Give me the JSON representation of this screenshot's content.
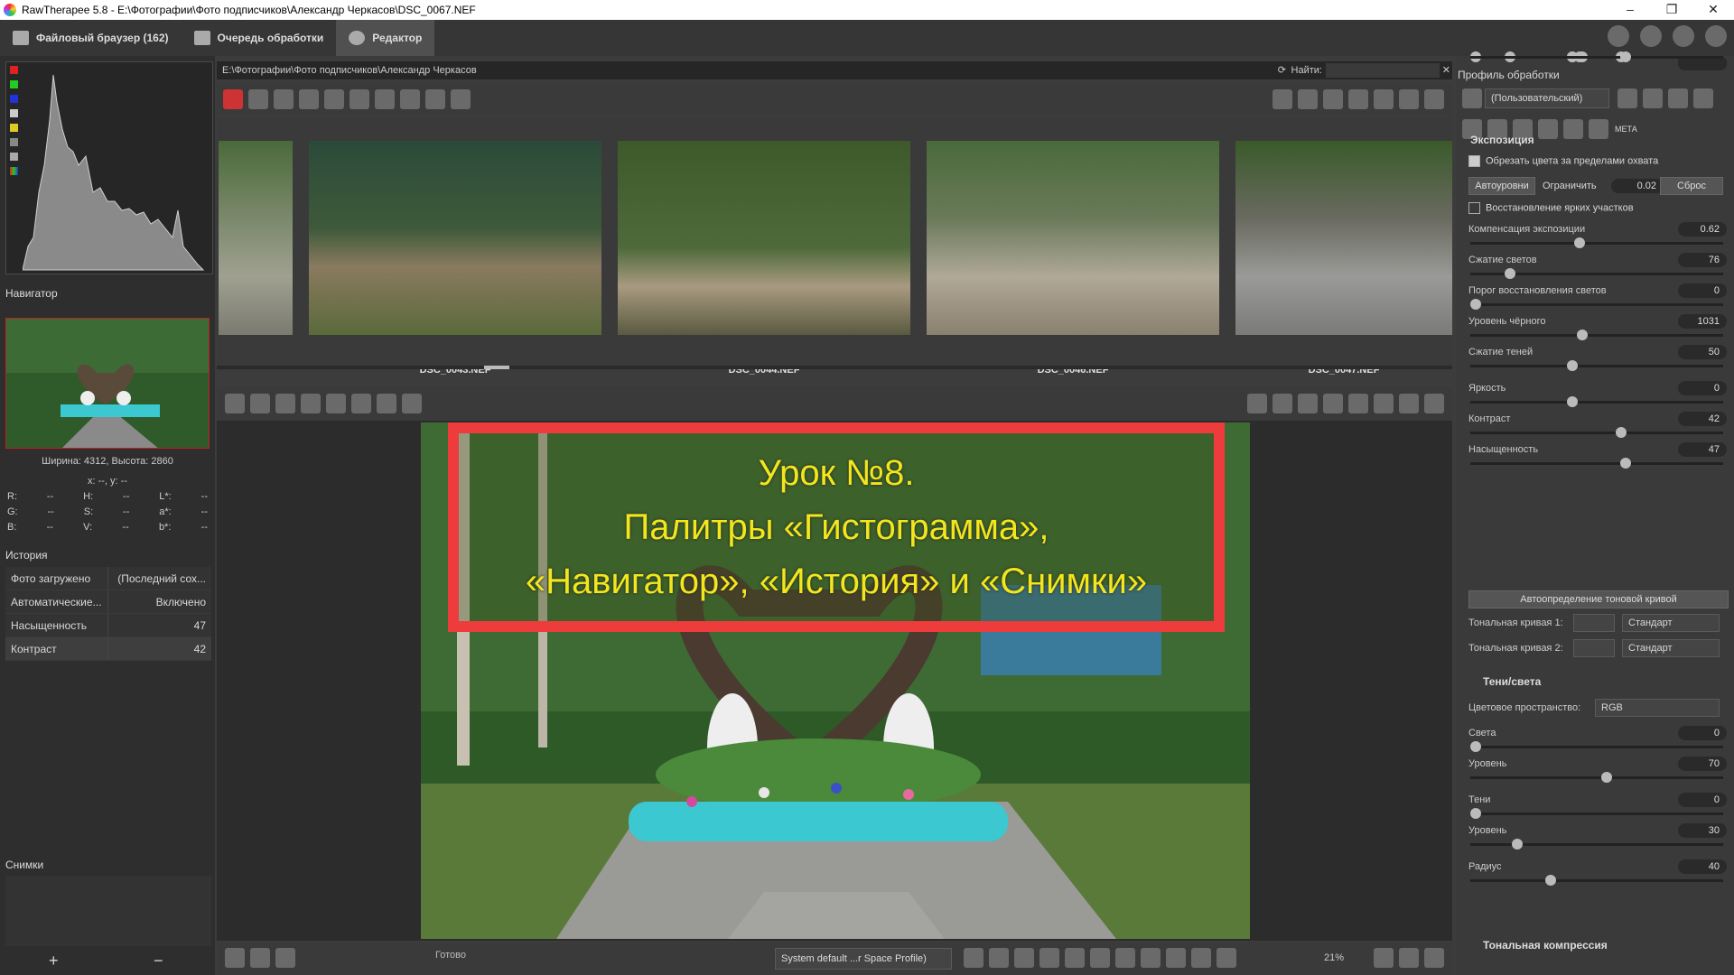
{
  "window": {
    "title": "RawTherapee 5.8 - E:\\Фотографии\\Фото подписчиков\\Александр Черкасов\\DSC_0067.NEF",
    "min": "–",
    "max": "❐",
    "close": "✕"
  },
  "tabs": [
    {
      "label": "Файловый браузер (162)"
    },
    {
      "label": "Очередь обработки"
    },
    {
      "label": "Редактор"
    }
  ],
  "left": {
    "navigator_title": "Навигатор",
    "dims": "Ширина: 4312, Высота: 2860",
    "coords": "x: --, y: --",
    "info": [
      [
        "R:",
        "--",
        "H:",
        "--",
        "L*:",
        "--"
      ],
      [
        "G:",
        "--",
        "S:",
        "--",
        "a*:",
        "--"
      ],
      [
        "B:",
        "--",
        "V:",
        "--",
        "b*:",
        "--"
      ]
    ],
    "history_title": "История",
    "history": [
      {
        "action": "Фото загружено",
        "value": "(Последний сох..."
      },
      {
        "action": "Автоматические...",
        "value": "Включено"
      },
      {
        "action": "Насыщенность",
        "value": "47"
      },
      {
        "action": "Контраст",
        "value": "42"
      }
    ],
    "snapshots_title": "Снимки",
    "add": "+",
    "remove": "−"
  },
  "filmstrip": {
    "path": "E:\\Фотографии\\Фото подписчиков\\Александр Черкасов",
    "find_label": "Найти:",
    "find_value": "",
    "thumbs": [
      {
        "name": ""
      },
      {
        "name": "DSC_0043.NEF"
      },
      {
        "name": "DSC_0044.NEF"
      },
      {
        "name": "DSC_0046.NEF"
      },
      {
        "name": "DSC_0047.NEF"
      }
    ]
  },
  "overlay": {
    "line1": "Урок №8.",
    "line2": "Палитры «Гистограмма»,",
    "line3": "«Навигатор», «История» и «Снимки»"
  },
  "bottom": {
    "status": "Готово",
    "profile": "System default ...r Space Profile)",
    "zoom": "21%"
  },
  "right": {
    "profile_title": "Профиль обработки",
    "profile_value": "(Пользовательский)",
    "meta_tab": "МЕТА",
    "exposure_title": "Экспозиция",
    "clip_oog": "Обрезать цвета за пределами охвата",
    "autolevels": "Автоуровни",
    "clip_label": "Ограничить",
    "clip_value": "0.02",
    "reset": "Сброс",
    "highlight_recovery": "Восстановление ярких участков",
    "sliders": [
      {
        "label": "Компенсация экспозиции",
        "value": "0.62",
        "pos": 0.43
      },
      {
        "label": "Сжатие светов",
        "value": "76",
        "pos": 0.14
      },
      {
        "label": "Порог восстановления светов",
        "value": "0",
        "pos": 0.0
      },
      {
        "label": "Уровень чёрного",
        "value": "1031",
        "pos": 0.44
      },
      {
        "label": "Сжатие теней",
        "value": "50",
        "pos": 0.4
      },
      {
        "label": "Яркость",
        "value": "0",
        "pos": 0.4
      },
      {
        "label": "Контраст",
        "value": "42",
        "pos": 0.6
      },
      {
        "label": "Насыщенность",
        "value": "47",
        "pos": 0.62
      }
    ],
    "auto_curve": "Автоопределение тоновой кривой",
    "curve1_label": "Тональная кривая 1:",
    "curve2_label": "Тональная кривая 2:",
    "curve_mode": "Стандарт",
    "sh_title": "Тени/света",
    "colorspace_label": "Цветовое пространство:",
    "colorspace_value": "RGB",
    "sh_sliders": [
      {
        "label": "Света",
        "value": "0",
        "pos": 0.0
      },
      {
        "label": "Уровень",
        "value": "70",
        "pos": 0.54
      },
      {
        "label": "Тени",
        "value": "0",
        "pos": 0.0
      },
      {
        "label": "Уровень",
        "value": "30",
        "pos": 0.17
      },
      {
        "label": "Радиус",
        "value": "40",
        "pos": 0.31
      }
    ],
    "tone_comp_title": "Тональная компрессия"
  },
  "colors": {
    "accent_red": "#ee3b3b",
    "overlay_text": "#f2e61c"
  }
}
